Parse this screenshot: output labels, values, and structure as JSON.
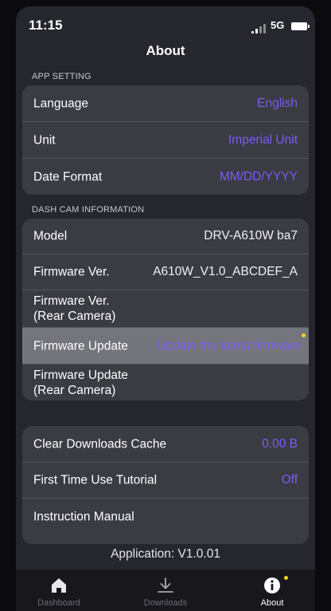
{
  "status_bar": {
    "time": "11:15",
    "network": "5G"
  },
  "nav": {
    "title": "About"
  },
  "app_setting": {
    "header": "APP SETTING",
    "rows": [
      {
        "label": "Language",
        "value": "English"
      },
      {
        "label": "Unit",
        "value": "Imperial Unit"
      },
      {
        "label": "Date Format",
        "value": "MM/DD/YYYY"
      }
    ]
  },
  "dash_cam": {
    "header": "DASH CAM INFORMATION",
    "rows": [
      {
        "label": "Model",
        "value": "DRV-A610W ba7"
      },
      {
        "label": "Firmware Ver.",
        "value": "A610W_V1.0_ABCDEF_A"
      },
      {
        "label": "Firmware Ver.\n(Rear Camera)",
        "value": ""
      },
      {
        "label": "Firmware Update",
        "value": "Update the latest firmware"
      },
      {
        "label": "Firmware Update\n(Rear Camera)",
        "value": ""
      }
    ]
  },
  "misc": {
    "rows": [
      {
        "label": "Clear Downloads Cache",
        "value": "0.00 B"
      },
      {
        "label": "First Time Use Tutorial",
        "value": "Off"
      },
      {
        "label": "Instruction Manual",
        "value": ""
      }
    ]
  },
  "footer": {
    "version": "Application:  V1.0.01"
  },
  "tabs": [
    {
      "label": "Dashboard",
      "icon": "home-icon",
      "active": false
    },
    {
      "label": "Downloads",
      "icon": "download-icon",
      "active": false
    },
    {
      "label": "About",
      "icon": "info-icon",
      "active": true
    }
  ],
  "colors": {
    "accent": "#7a5cf5",
    "badge": "#f5d21e",
    "background": "#26262e",
    "card": "#3b3b44",
    "highlight": "#74747c"
  }
}
